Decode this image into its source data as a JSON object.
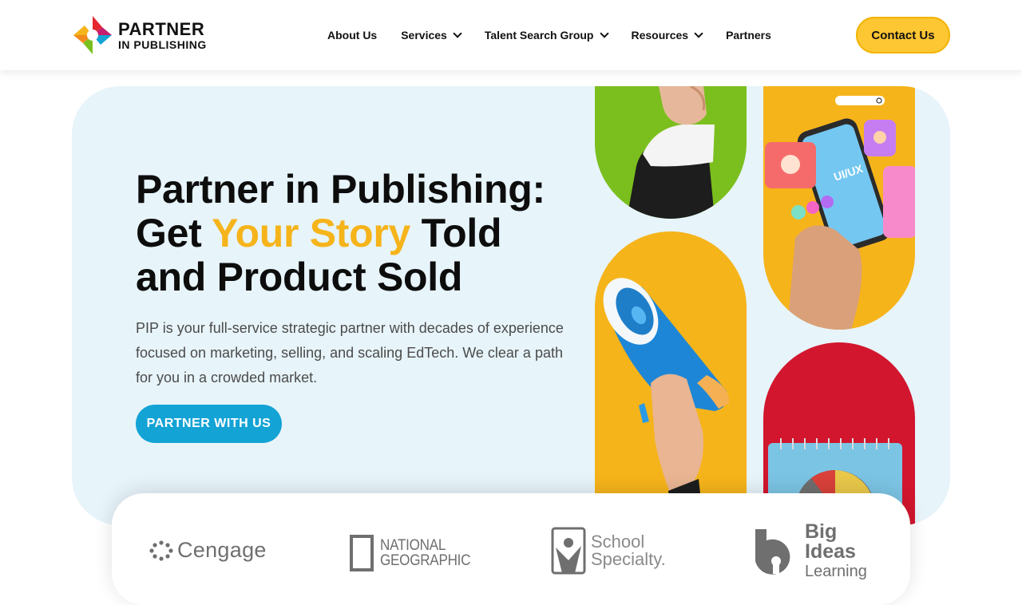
{
  "brand": {
    "line1": "PARTNER",
    "line2": "IN PUBLISHING",
    "colors": {
      "red": "#e5282e",
      "yellow": "#f6b41b",
      "blue": "#13a3d5",
      "green": "#7bbf1e"
    }
  },
  "nav": {
    "items": [
      {
        "label": "About Us",
        "has_dropdown": false
      },
      {
        "label": "Services",
        "has_dropdown": true
      },
      {
        "label": "Talent Search Group",
        "has_dropdown": true
      },
      {
        "label": "Resources",
        "has_dropdown": true
      },
      {
        "label": "Partners",
        "has_dropdown": false
      }
    ],
    "contact_label": "Contact Us"
  },
  "hero": {
    "title_line1": "Partner in Publishing:",
    "title_get": "Get ",
    "title_highlight": "Your Story",
    "title_told": " Told",
    "title_line3": "and Product Sold",
    "description": "PIP is your full-service strategic partner with decades of experience focused on marketing, selling, and scaling EdTech. We clear a path for you in a crowded market.",
    "cta_label": "PARTNER WITH US",
    "phone_screen_text": "UI/UX"
  },
  "partners": {
    "logos": [
      {
        "name": "Cengage"
      },
      {
        "name": "NATIONAL GEOGRAPHIC",
        "line1": "NATIONAL",
        "line2": "GEOGRAPHIC"
      },
      {
        "name": "School Specialty",
        "line1": "School",
        "line2": "Specialty."
      },
      {
        "name": "Big Ideas Learning",
        "line1": "Big",
        "line2": "Ideas",
        "line3": "Learning"
      }
    ]
  }
}
